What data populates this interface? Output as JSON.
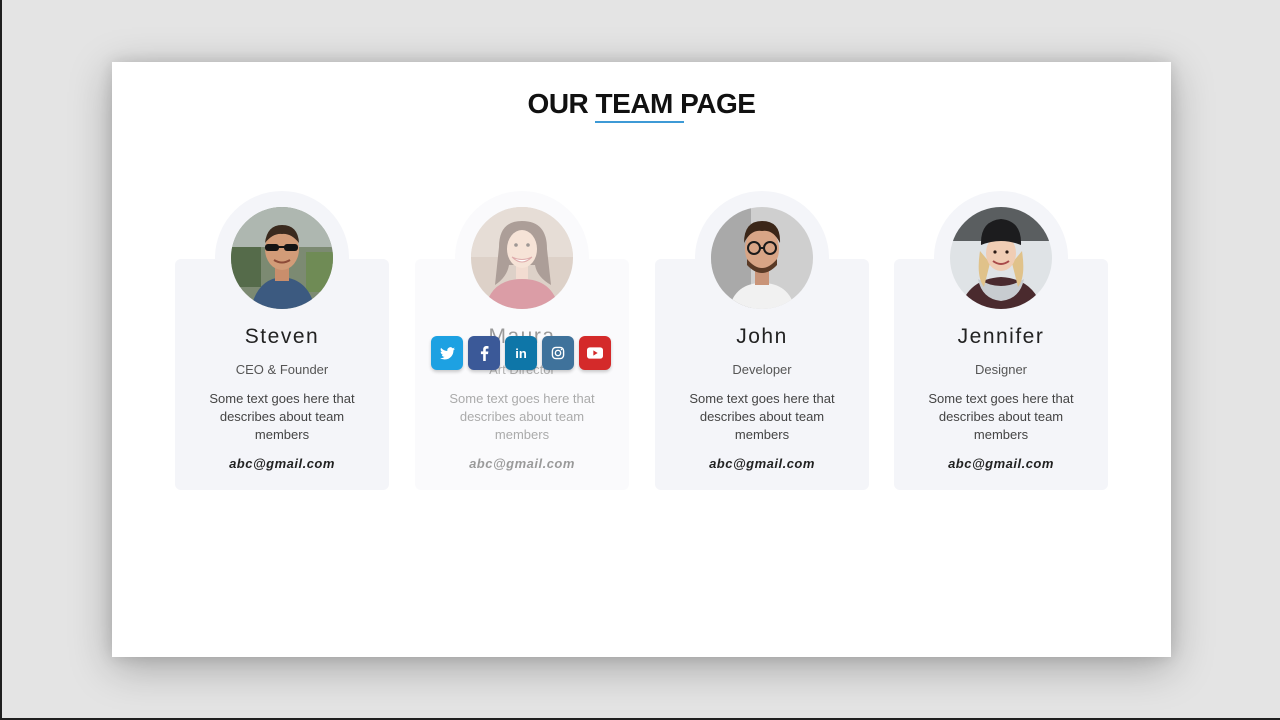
{
  "page": {
    "title": "OUR TEAM PAGE"
  },
  "colors": {
    "accent": "#3d9ad6",
    "card_background": "#f4f5f9",
    "twitter": "#1da1e2",
    "facebook": "#3b5998",
    "linkedin": "#0e76a8",
    "instagram": "#3f729b",
    "youtube": "#d42a2a"
  },
  "team": [
    {
      "name": "Steven",
      "role": "CEO & Founder",
      "description": "Some text goes here that describes about team members",
      "email": "abc@gmail.com"
    },
    {
      "name": "Maura",
      "role": "Art Director",
      "description": "Some text goes here that describes about team members",
      "email": "abc@gmail.com"
    },
    {
      "name": "John",
      "role": "Developer",
      "description": "Some text goes here that describes about team members",
      "email": "abc@gmail.com"
    },
    {
      "name": "Jennifer",
      "role": "Designer",
      "description": "Some text goes here that describes about team members",
      "email": "abc@gmail.com"
    }
  ],
  "social": [
    {
      "icon": "twitter-icon"
    },
    {
      "icon": "facebook-icon"
    },
    {
      "icon": "linkedin-icon",
      "label": "in"
    },
    {
      "icon": "instagram-icon"
    },
    {
      "icon": "youtube-icon"
    }
  ]
}
